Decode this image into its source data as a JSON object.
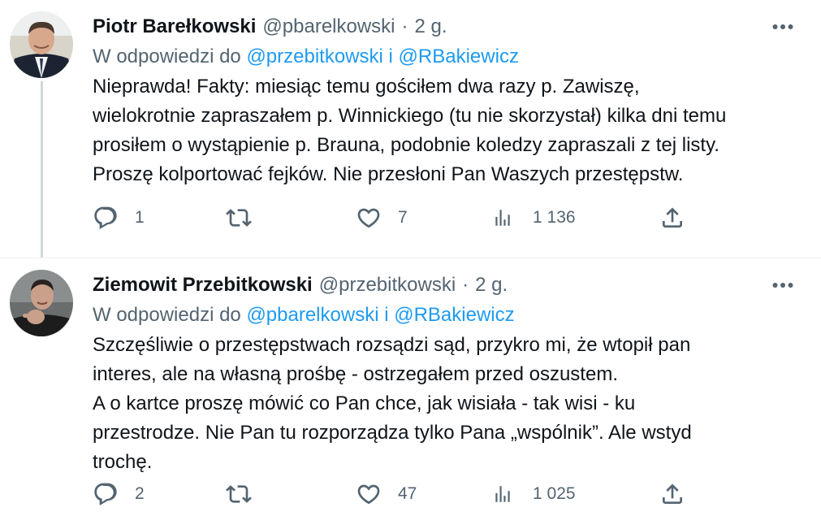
{
  "tweets": [
    {
      "author": {
        "name": "Piotr Barełkowski",
        "handle": "@pbarelkowski",
        "time": "2 g.",
        "avatar": "avatar-photo-man-suit"
      },
      "reply_to": {
        "prefix": "W odpowiedzi do",
        "mention_1": "@przebitkowski",
        "joiner": "i",
        "mention_2": "@RBakiewicz"
      },
      "body_lines": [
        "Nieprawda! Fakty: miesiąc temu gościłem dwa razy p. Zawiszę,",
        "wielokrotnie zapraszałem p. Winnickiego (tu nie skorzystał) kilka dni temu",
        "prosiłem o wystąpienie p. Brauna, podobnie koledzy zapraszali z tej listy.",
        "Proszę kolportować fejków. Nie przesłoni Pan Waszych przestępstw."
      ],
      "stats": {
        "replies": "1",
        "retweets": "",
        "likes": "7",
        "views": "1 136"
      }
    },
    {
      "author": {
        "name": "Ziemowit Przebitkowski",
        "handle": "@przebitkowski",
        "time": "2 g.",
        "avatar": "avatar-photo-man-pointing"
      },
      "reply_to": {
        "prefix": "W odpowiedzi do",
        "mention_1": "@pbarelkowski",
        "joiner": "i",
        "mention_2": "@RBakiewicz"
      },
      "body_lines": [
        "Szczęśliwie o przestępstwach rozsądzi sąd, przykro mi, że wtopił pan",
        "interes, ale na własną prośbę - ostrzegałem przed oszustem.",
        "A o kartce proszę mówić co Pan chce, jak wisiała - tak wisi - ku",
        "przestrodze. Nie Pan tu rozporządza tylko Pana „wspólnik”. Ale wstyd",
        "trochę."
      ],
      "stats": {
        "replies": "2",
        "retweets": "",
        "likes": "47",
        "views": "1 025"
      }
    }
  ],
  "icons": {
    "more": "more-horizontal-icon",
    "reply": "reply-icon",
    "retweet": "retweet-icon",
    "like": "heart-icon",
    "views": "views-icon",
    "share": "share-icon"
  },
  "colors": {
    "text": "#0f1419",
    "secondary": "#536471",
    "link": "#1d9bf0",
    "thread_line": "#cfd9de",
    "divider": "#eff3f4"
  }
}
